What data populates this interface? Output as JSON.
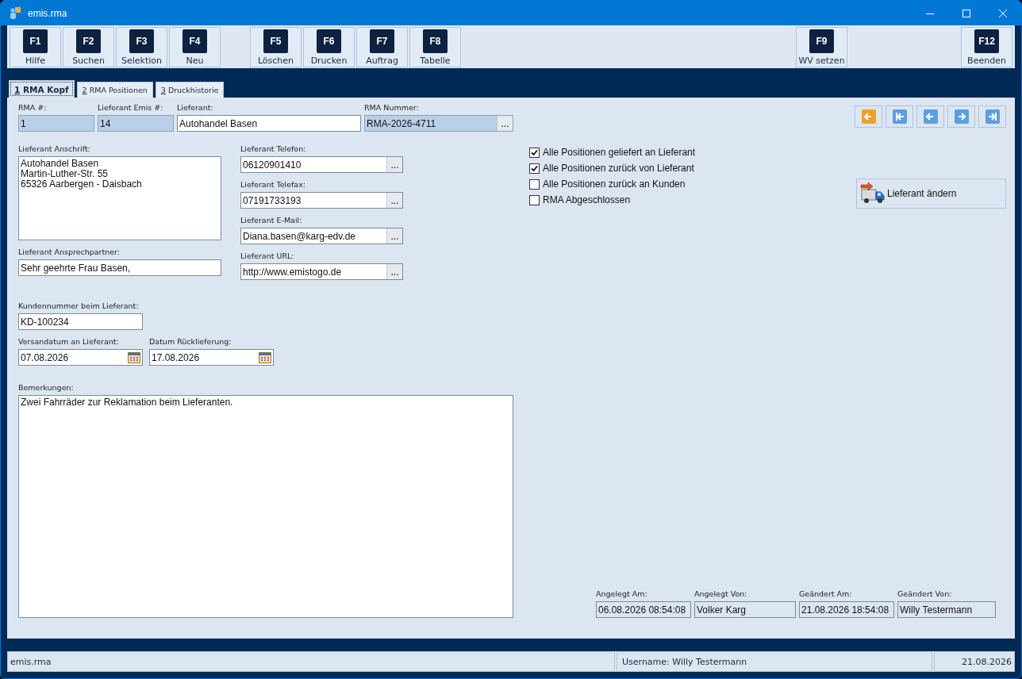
{
  "window": {
    "title": "emis.rma"
  },
  "toolbar": {
    "groups": [
      [
        {
          "key": "F1",
          "label": "Hilfe"
        },
        {
          "key": "F2",
          "label": "Suchen"
        },
        {
          "key": "F3",
          "label": "Selektion"
        },
        {
          "key": "F4",
          "label": "Neu"
        }
      ],
      [
        {
          "key": "F5",
          "label": "Löschen"
        },
        {
          "key": "F6",
          "label": "Drucken"
        },
        {
          "key": "F7",
          "label": "Auftrag"
        },
        {
          "key": "F8",
          "label": "Tabelle"
        }
      ],
      [
        {
          "key": "F9",
          "label": "WV setzen"
        }
      ],
      [
        {
          "key": "F12",
          "label": "Beenden"
        }
      ]
    ]
  },
  "tabs": [
    {
      "key": "1",
      "label": "RMA Kopf",
      "selected": true
    },
    {
      "key": "2",
      "label": "RMA Positionen",
      "selected": false
    },
    {
      "key": "3",
      "label": "Druckhistorie",
      "selected": false
    }
  ],
  "header_fields": [
    {
      "label": "RMA #:",
      "value": "1",
      "readonly": true
    },
    {
      "label": "Lieferant Emis #:",
      "value": "14",
      "readonly": true
    },
    {
      "label": "Lieferant:",
      "value": "Autohandel Basen",
      "readonly": false
    },
    {
      "label": "RMA Nummer:",
      "value": "RMA-2026-4711",
      "readonly": true,
      "button_label": "..."
    }
  ],
  "supplier_address": {
    "label": "Lieferant Anschrift:",
    "lines": [
      "Autohandel Basen",
      "Martin-Luther-Str. 55",
      "65326 Aarbergen - Daisbach"
    ]
  },
  "contact_person": {
    "label": "Lieferant Ansprechpartner:",
    "value": "Sehr geehrte Frau Basen,"
  },
  "supplier_contacts": [
    {
      "label": "Lieferant Telefon:",
      "value": "06120901410",
      "button_label": "..."
    },
    {
      "label": "Lieferant Telefax:",
      "value": "07191733193",
      "button_label": "..."
    },
    {
      "label": "Lieferant E-Mail:",
      "value": "Diana.basen@karg-edv.de",
      "button_label": "..."
    },
    {
      "label": "Lieferant URL:",
      "value": "http://www.emistogo.de",
      "button_label": "..."
    }
  ],
  "customer_number": {
    "label": "Kundennummer beim Lieferant:",
    "value": "KD-100234"
  },
  "dates": [
    {
      "label": "Versandatum an Lieferant:",
      "value": "07.08.2026"
    },
    {
      "label": "Datum Rücklieferung:",
      "value": "17.08.2026"
    }
  ],
  "remarks": {
    "label": "Bemerkungen:",
    "value": "Zwei Fahrräder zur Reklamation beim Lieferanten."
  },
  "nav_buttons": [
    {
      "kind": "back"
    },
    {
      "kind": "first"
    },
    {
      "kind": "previous"
    },
    {
      "kind": "next"
    },
    {
      "kind": "last"
    }
  ],
  "checkboxes": [
    {
      "label": "Alle Positionen geliefert an Lieferant",
      "checked": true
    },
    {
      "label": "Alle Positionen zurück von Lieferant",
      "checked": true
    },
    {
      "label": "Alle Positionen zurück an Kunden",
      "checked": false
    },
    {
      "label": "RMA Abgeschlossen",
      "checked": false
    }
  ],
  "change_supplier_button": {
    "label": "Lieferant ändern"
  },
  "audit": [
    {
      "label": "Angelegt Am:",
      "value": "06.08.2026 08:54:08"
    },
    {
      "label": "Angelegt Von:",
      "value": "Volker Karg"
    },
    {
      "label": "Geändert Am:",
      "value": "21.08.2026 18:54:08"
    },
    {
      "label": "Geändert Von:",
      "value": "Willy Testermann"
    }
  ],
  "status_bar": {
    "app": "emis.rma",
    "user": "Username: Willy Testermann",
    "date": "21.08.2026"
  }
}
